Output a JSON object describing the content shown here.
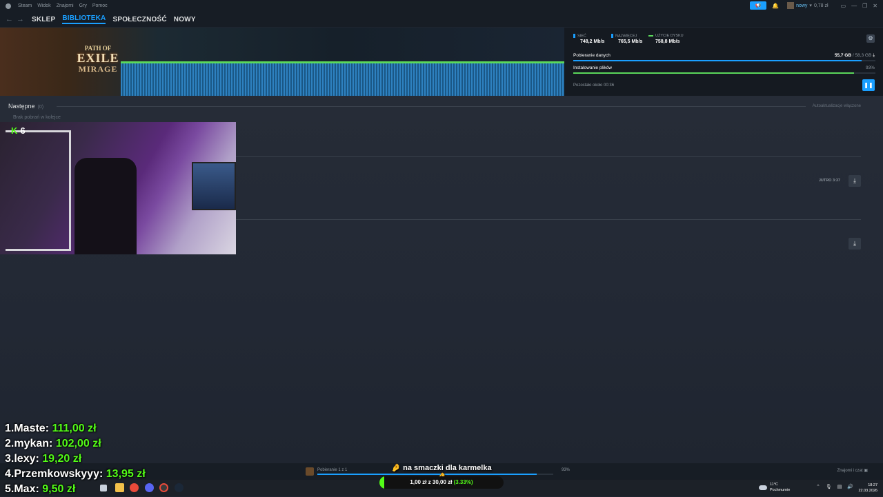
{
  "menubar": {
    "items": [
      "Steam",
      "Widok",
      "Znajomi",
      "Gry",
      "Pomoc"
    ]
  },
  "user": {
    "name": "nowy",
    "balance": "0,78 zł"
  },
  "nav": {
    "back": "←",
    "forward": "→",
    "links": [
      "SKLEP",
      "BIBLIOTEKA",
      "SPOŁECZNOŚĆ",
      "NOWY"
    ],
    "active": "BIBLIOTEKA"
  },
  "game_logo": {
    "line1": "PATH OF",
    "line2": "EXILE",
    "line3": "MIRAGE"
  },
  "stats": {
    "network": {
      "label": "SIEĆ",
      "value": "748,2 Mb/s",
      "color": "#1a9fff"
    },
    "peak": {
      "label": "NAJWIĘCEJ",
      "value": "765,5 Mb/s",
      "color": "#1a9fff"
    },
    "disk": {
      "label": "UŻYCIE DYSKU",
      "value": "758,8 Mb/s",
      "color": "#5bd85b"
    }
  },
  "download": {
    "data_label": "Pobieranie danych",
    "data_amount": "55,7 GB",
    "data_total": "/ 58,3 GB",
    "data_progress": 0.955,
    "install_label": "Instalowanie plików",
    "install_pct": "93%",
    "install_progress": 0.93,
    "remaining": "Pozostało około 00:36",
    "pause_icon": "pause-icon"
  },
  "queue": {
    "title": "Następne",
    "count": "(0)",
    "auto_update": "Autoaktualizacje włączone",
    "empty": "Brak pobrań w kolejce",
    "row1_time": "JUTRO 3:37"
  },
  "webcam": {
    "badge_num": "6",
    "badge_k": "K"
  },
  "leaderboard": [
    {
      "rank": "1.",
      "name": "Maste:",
      "amount": "111,00 zł"
    },
    {
      "rank": "2.",
      "name": "mykan:",
      "amount": "102,00 zł"
    },
    {
      "rank": "3.",
      "name": "lexy:",
      "amount": "19,20 zł"
    },
    {
      "rank": "4.",
      "name": "Przemkowskyyy:",
      "amount": "13,95 zł"
    },
    {
      "rank": "5.",
      "name": "Max:",
      "amount": "9,50 zł"
    }
  ],
  "bottombar": {
    "progress_label": "Pobieranie 1 z 1",
    "progress_pct": "93%",
    "progress": 0.93,
    "friends": "Znajomi i czat"
  },
  "donation": {
    "title": "🤌 na smaczki dla karmelka 🤌",
    "current": "1,00 zł",
    "sep": "z",
    "goal": "30,00 zł",
    "pct": "(3.33%)",
    "progress": 0.0333
  },
  "taskbar": {
    "weather_temp": "11°C",
    "weather_desc": "Pochmurnie",
    "time": "18:27",
    "date": "22.03.2026"
  }
}
